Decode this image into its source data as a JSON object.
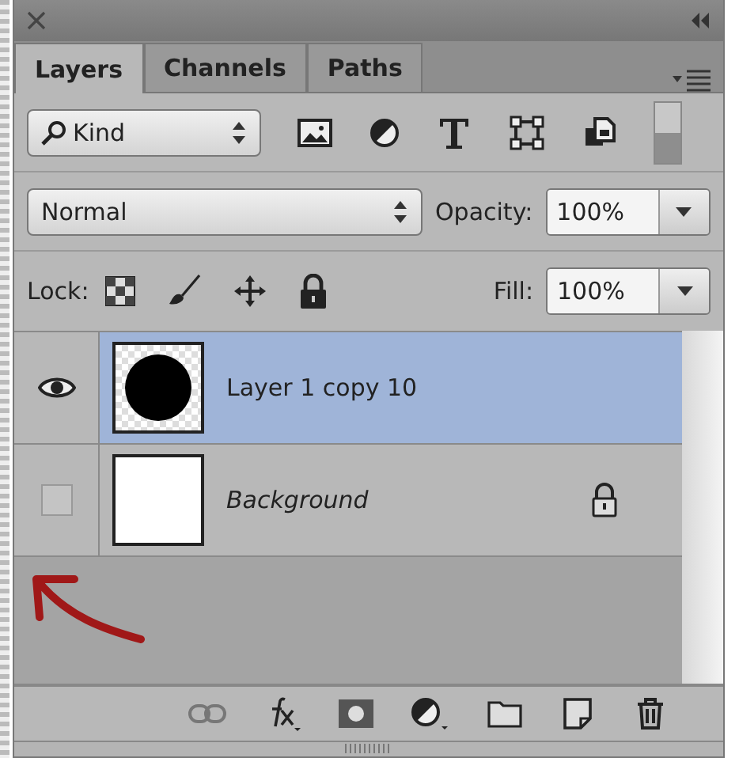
{
  "tabs": [
    {
      "label": "Layers",
      "selected": true
    },
    {
      "label": "Channels",
      "selected": false
    },
    {
      "label": "Paths",
      "selected": false
    }
  ],
  "filter": {
    "value": "Kind",
    "filter_on": true
  },
  "blend": {
    "value": "Normal",
    "opacity_label": "Opacity:",
    "opacity": "100%"
  },
  "lock": {
    "label": "Lock:",
    "fill_label": "Fill:",
    "fill": "100%"
  },
  "layers": [
    {
      "name": "Layer 1 copy 10",
      "kind": "shape",
      "visible": true,
      "selected": true,
      "locked": false
    },
    {
      "name": "Background",
      "kind": "background",
      "visible": false,
      "selected": false,
      "locked": true
    }
  ]
}
